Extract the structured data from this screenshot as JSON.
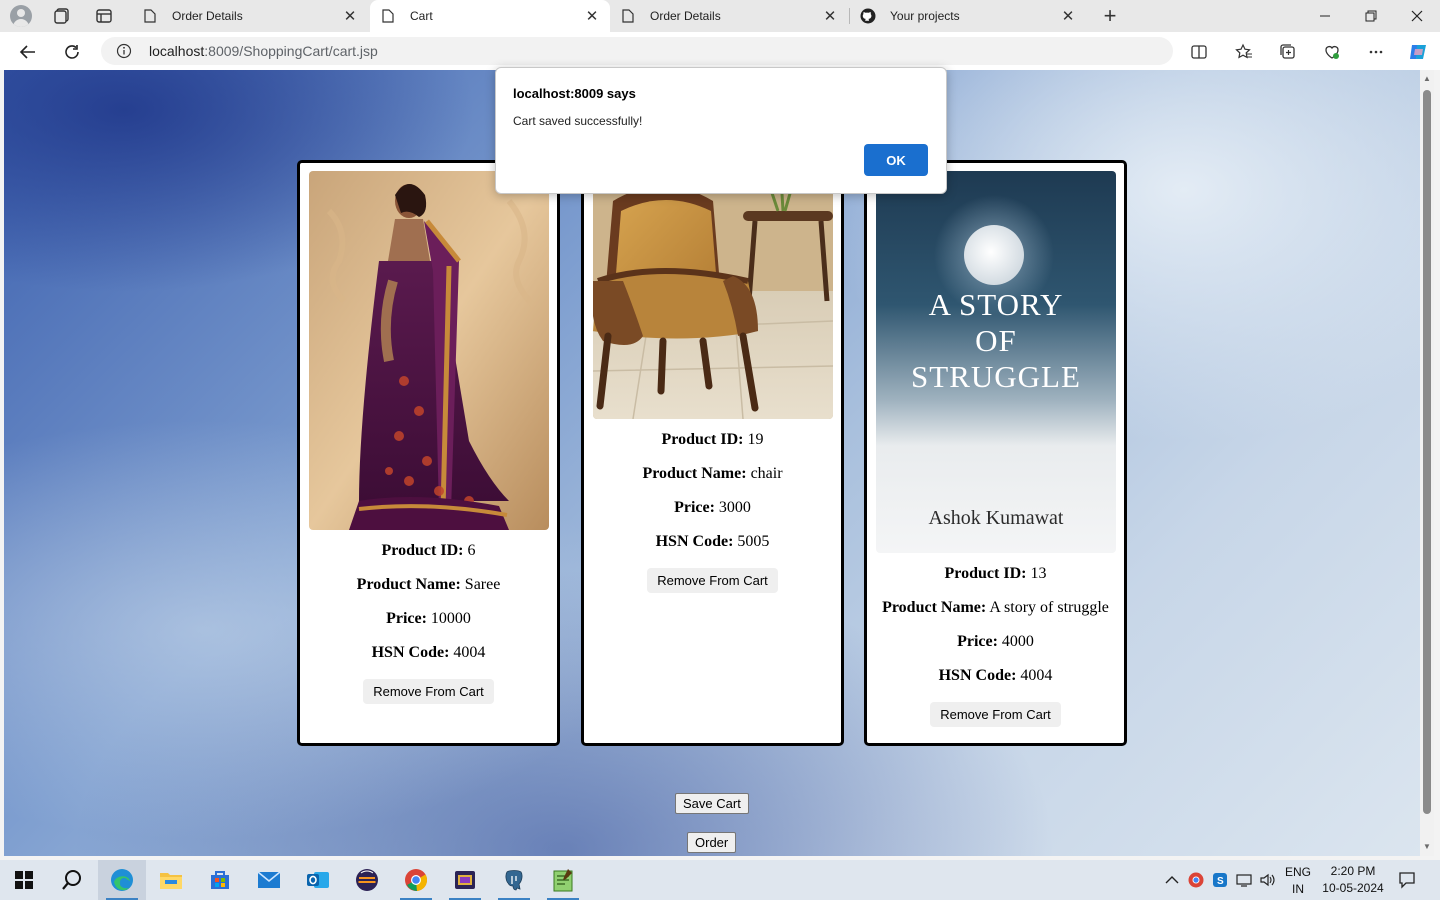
{
  "browser": {
    "tabs": [
      {
        "title": "Order Details",
        "active": false
      },
      {
        "title": "Cart",
        "active": true
      },
      {
        "title": "Order Details",
        "active": false
      },
      {
        "title": "Your projects",
        "active": false
      }
    ],
    "address": {
      "host": "localhost",
      "rest": ":8009/ShoppingCart/cart.jsp"
    }
  },
  "dialog": {
    "title": "localhost:8009 says",
    "message": "Cart saved successfully!",
    "ok_label": "OK"
  },
  "cart": {
    "labels": {
      "id": "Product ID:",
      "name": "Product Name:",
      "price": "Price:",
      "hsn": "HSN Code:"
    },
    "items": [
      {
        "id": "6",
        "name": "Saree",
        "price": "10000",
        "hsn": "4004",
        "remove_label": "Remove From Cart"
      },
      {
        "id": "19",
        "name": "chair",
        "price": "3000",
        "hsn": "5005",
        "remove_label": "Remove From Cart"
      },
      {
        "id": "13",
        "name": "A story of struggle",
        "price": "4000",
        "hsn": "4004",
        "remove_label": "Remove From Cart"
      }
    ],
    "book_cover": {
      "title_line1": "A STORY",
      "title_line2": "OF",
      "title_line3": "STRUGGLE",
      "author": "Ashok Kumawat"
    }
  },
  "actions": {
    "save_label": "Save Cart",
    "order_label": "Order"
  },
  "taskbar": {
    "language": "ENG",
    "region": "IN",
    "time": "2:20 PM",
    "date": "10-05-2024"
  },
  "colors": {
    "ok_button": "#1a6fcf",
    "accent": "#3b82c4"
  }
}
